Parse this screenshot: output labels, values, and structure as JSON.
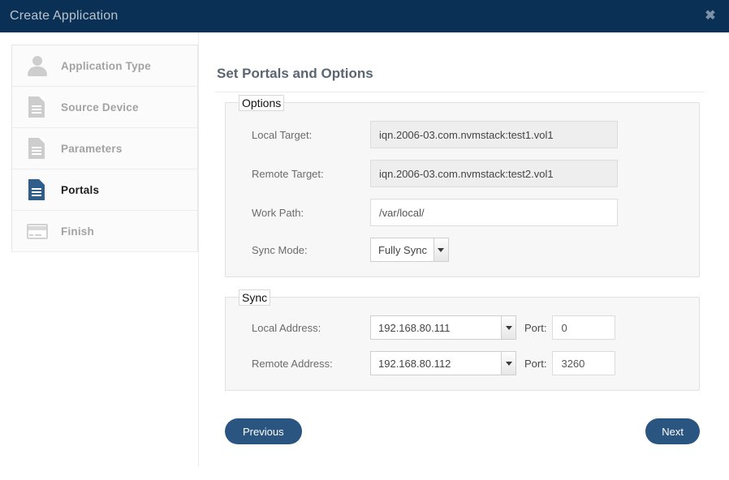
{
  "window": {
    "title": "Create Application",
    "close_icon": "close-icon",
    "close_glyph": "✖"
  },
  "theme": {
    "titlebar_bg": "#0a3055",
    "button_bg": "#2a5580",
    "active_icon": "#2f5e8d",
    "muted_text": "#a3a3a3"
  },
  "sidebar": {
    "items": [
      {
        "label": "Application Type",
        "icon": "user-icon",
        "active": false
      },
      {
        "label": "Source Device",
        "icon": "document-icon",
        "active": false
      },
      {
        "label": "Parameters",
        "icon": "document-icon",
        "active": false
      },
      {
        "label": "Portals",
        "icon": "document-icon",
        "active": true
      },
      {
        "label": "Finish",
        "icon": "card-icon",
        "active": false
      }
    ]
  },
  "main": {
    "title": "Set Portals and Options",
    "options": {
      "legend": "Options",
      "local_target": {
        "label": "Local Target:",
        "value": "iqn.2006-03.com.nvmstack:test1.vol1",
        "readonly": true
      },
      "remote_target": {
        "label": "Remote Target:",
        "value": "iqn.2006-03.com.nvmstack:test2.vol1",
        "readonly": true
      },
      "work_path": {
        "label": "Work Path:",
        "value": "/var/local/",
        "readonly": false
      },
      "sync_mode": {
        "label": "Sync Mode:",
        "value": "Fully Sync"
      }
    },
    "sync": {
      "legend": "Sync",
      "local_address": {
        "label": "Local Address:",
        "value": "192.168.80.111",
        "port_label": "Port:",
        "port_value": "0"
      },
      "remote_address": {
        "label": "Remote Address:",
        "value": "192.168.80.112",
        "port_label": "Port:",
        "port_value": "3260"
      }
    }
  },
  "footer": {
    "previous_label": "Previous",
    "next_label": "Next"
  }
}
